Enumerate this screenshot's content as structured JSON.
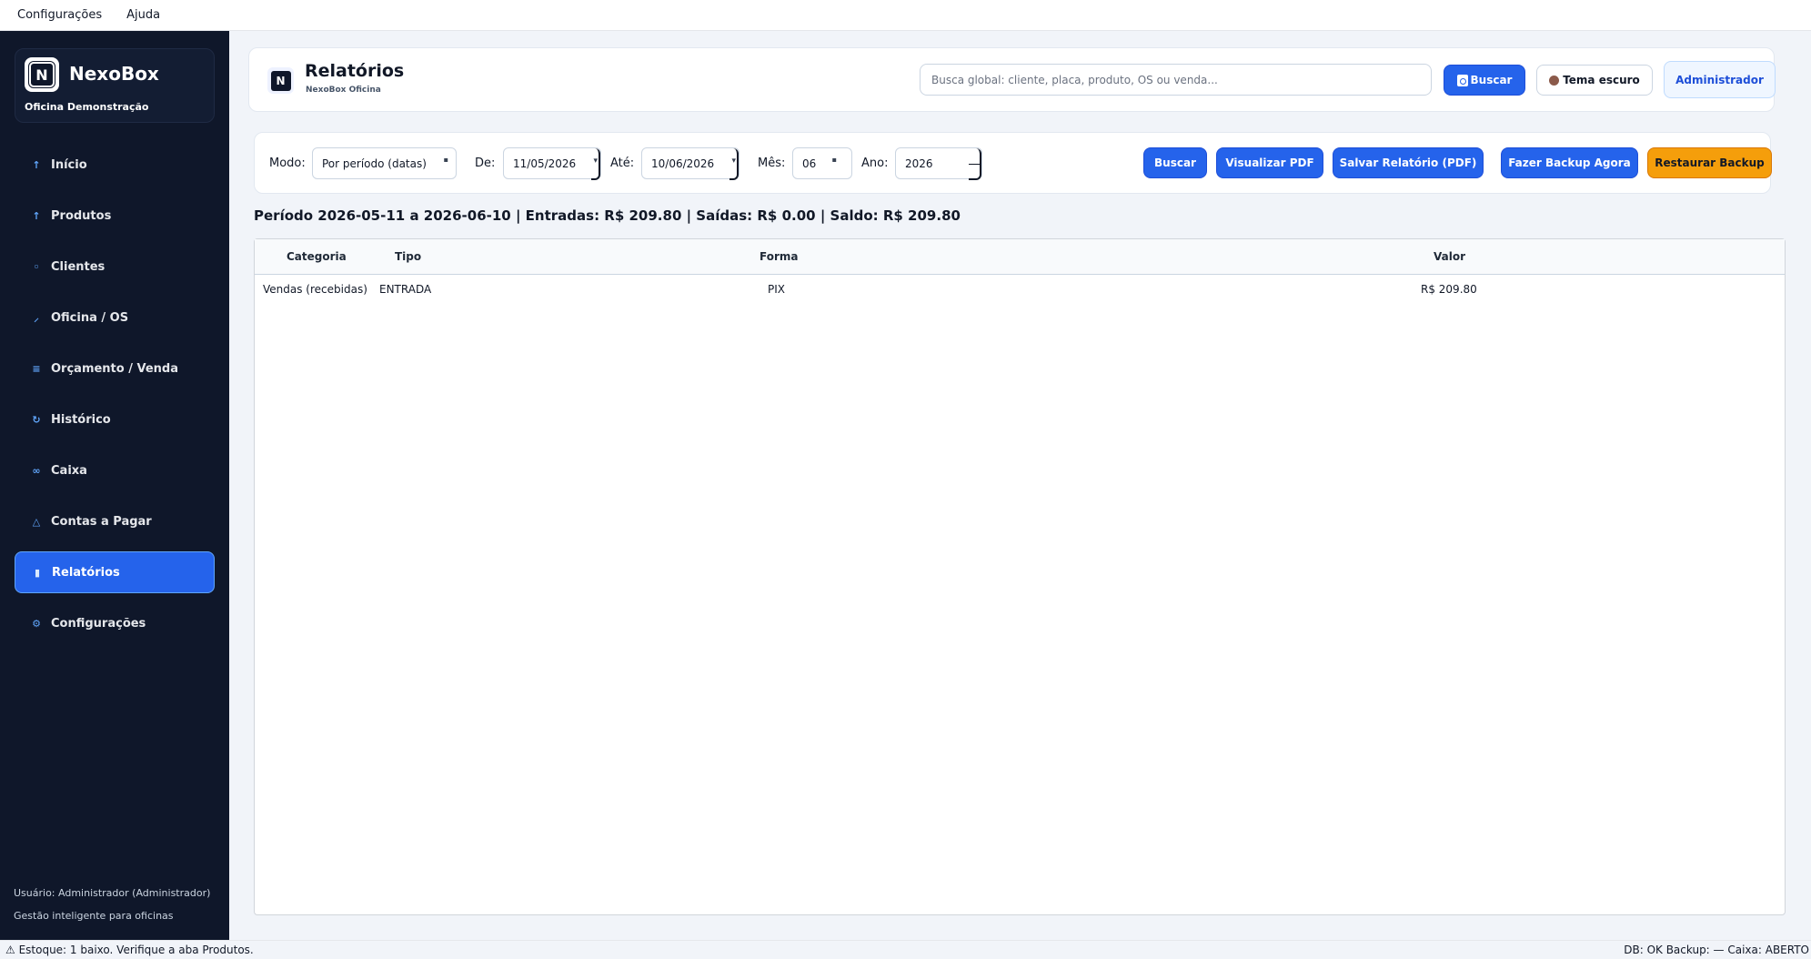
{
  "menubar": {
    "items": [
      "Configurações",
      "Ajuda"
    ]
  },
  "brand": {
    "logo_text": "N",
    "name": "NexoBox",
    "subtitle": "Oficina Demonstração"
  },
  "sidebar": {
    "items": [
      {
        "label": "Início",
        "icon": "arrow-up-icon",
        "glyph": "↑"
      },
      {
        "label": "Produtos",
        "icon": "arrow-up-icon",
        "glyph": "↑"
      },
      {
        "label": "Clientes",
        "icon": "person-icon",
        "glyph": "◦"
      },
      {
        "label": "Oficina / OS",
        "icon": "wrench-icon",
        "glyph": "⸝"
      },
      {
        "label": "Orçamento / Venda",
        "icon": "list-icon",
        "glyph": "≡"
      },
      {
        "label": "Histórico",
        "icon": "history-icon",
        "glyph": "↻"
      },
      {
        "label": "Caixa",
        "icon": "cash-icon",
        "glyph": "∞"
      },
      {
        "label": "Contas a Pagar",
        "icon": "warning-icon",
        "glyph": "△"
      },
      {
        "label": "Relatórios",
        "icon": "report-icon",
        "glyph": "▮"
      },
      {
        "label": "Configurações",
        "icon": "gear-icon",
        "glyph": "⚙"
      }
    ],
    "active_index": 8,
    "footer_user": "Usuário: Administrador (Administrador)",
    "footer_tagline": "Gestão inteligente para oficinas"
  },
  "header": {
    "logo_text": "N",
    "title": "Relatórios",
    "subtitle": "NexoBox Oficina",
    "search_placeholder": "Busca global: cliente, placa, produto, OS ou venda...",
    "search_button": "Buscar",
    "theme_button": "Tema escuro",
    "user_button": "Administrador"
  },
  "filters": {
    "mode_label": "Modo:",
    "mode_value": "Por período (datas)",
    "from_label": "De:",
    "from_value": "11/05/2026",
    "to_label": "Até:",
    "to_value": "10/06/2026",
    "month_label": "Mês:",
    "month_value": "06",
    "year_label": "Ano:",
    "year_value": "2026",
    "buttons": {
      "search": "Buscar",
      "view_pdf": "Visualizar PDF",
      "save_pdf": "Salvar Relatório (PDF)",
      "backup_now": "Fazer Backup Agora",
      "restore": "Restaurar Backup"
    }
  },
  "summary": "Período 2026-05-11 a 2026-06-10 | Entradas: R$ 209.80 | Saídas: R$ 0.00 | Saldo: R$ 209.80",
  "table": {
    "columns": [
      "Categoria",
      "Tipo",
      "Forma",
      "Valor"
    ],
    "rows": [
      [
        "Vendas (recebidas)",
        "ENTRADA",
        "PIX",
        "R$ 209.80"
      ]
    ]
  },
  "statusbar": {
    "left": "⚠ Estoque: 1 baixo. Verifique a aba Produtos.",
    "right": "DB: OK   Backup: —   Caixa: ABERTO"
  }
}
